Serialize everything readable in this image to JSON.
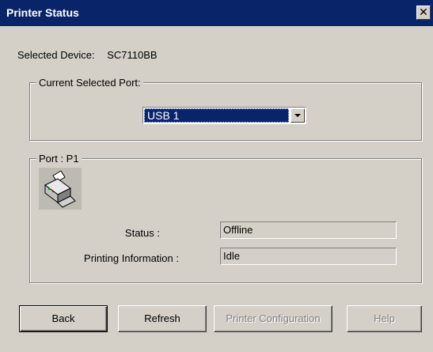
{
  "window": {
    "title": "Printer Status",
    "close_glyph": "✕"
  },
  "device": {
    "label": "Selected Device:",
    "value": "SC7110BB"
  },
  "port_group": {
    "legend": "Current Selected Port:",
    "selected": "USB 1"
  },
  "status_group": {
    "legend": "Port : P1",
    "icon": "printer-icon",
    "status_label": "Status :",
    "status_value": "Offline",
    "printing_label": "Printing Information :",
    "printing_value": "Idle"
  },
  "buttons": {
    "back": "Back",
    "refresh": "Refresh",
    "config": "Printer Configuration",
    "help": "Help"
  },
  "colors": {
    "titlebar": "#0a246a",
    "face": "#d4d0c8",
    "selection": "#0a246a"
  }
}
